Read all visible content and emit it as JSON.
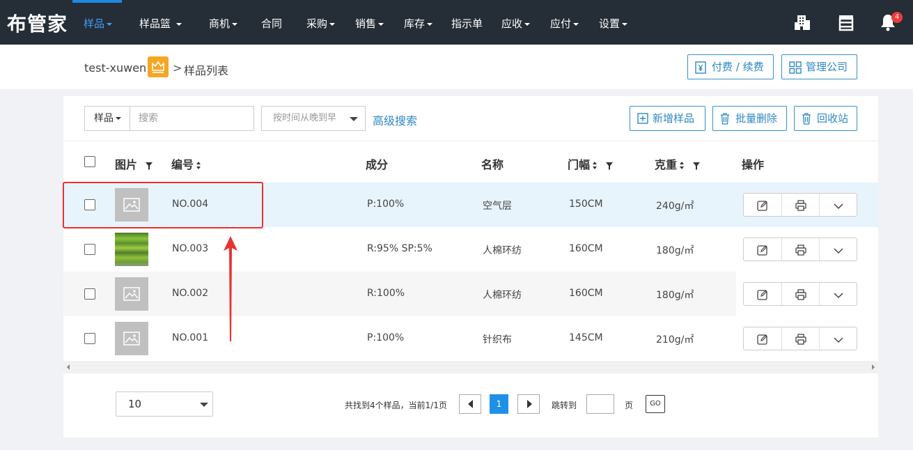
{
  "nav": {
    "logo": "布管家",
    "items": [
      {
        "label": "样品",
        "caret": true,
        "active": true
      },
      {
        "label": "样品篮 ",
        "caret": true
      },
      {
        "label": "商机",
        "caret": true
      },
      {
        "label": "合同",
        "caret": false
      },
      {
        "label": "采购",
        "caret": true
      },
      {
        "label": "销售",
        "caret": true
      },
      {
        "label": "库存",
        "caret": true
      },
      {
        "label": "指示单",
        "caret": false
      },
      {
        "label": "应收",
        "caret": true
      },
      {
        "label": "应付",
        "caret": true
      },
      {
        "label": "设置",
        "caret": true
      }
    ],
    "icons": [
      "building-icon",
      "store-icon",
      "bell-icon"
    ],
    "notification_count": "4"
  },
  "breadcrumb": {
    "user": "test-xuwen",
    "separator": ">",
    "page": "样品列表"
  },
  "header_buttons": {
    "pay": "付费 / 续费",
    "manage_company": "管理公司"
  },
  "toolbar": {
    "search_type": "样品",
    "search_placeholder": "搜索",
    "sort_option": "按时间从晚到早",
    "advanced_search": "高级搜索",
    "add_sample": "新增样品",
    "batch_delete": "批量删除",
    "recycle_bin": "回收站"
  },
  "table": {
    "columns": {
      "image": "图片",
      "code": "编号",
      "composition": "成分",
      "name": "名称",
      "width": "门幅",
      "weight": "克重",
      "actions": "操作"
    },
    "rows": [
      {
        "code": "NO.004",
        "composition": "P:100%",
        "name": "空气层",
        "width": "150CM",
        "weight": "240g/㎡",
        "image": "placeholder"
      },
      {
        "code": "NO.003",
        "composition": "R:95% SP:5%",
        "name": "人棉环纺",
        "width": "160CM",
        "weight": "180g/㎡",
        "image": "photo"
      },
      {
        "code": "NO.002",
        "composition": "R:100%",
        "name": "人棉环纺",
        "width": "160CM",
        "weight": "180g/㎡",
        "image": "placeholder"
      },
      {
        "code": "NO.001",
        "composition": "P:100%",
        "name": "针织布",
        "width": "145CM",
        "weight": "210g/㎡",
        "image": "placeholder"
      }
    ]
  },
  "pagination": {
    "page_size": "10",
    "info": "共找到4个样品，当前1/1页",
    "current_page": "1",
    "jump_label": "跳转到",
    "jump_unit": "页",
    "go": "GO"
  },
  "colors": {
    "nav_bg": "#252d36",
    "accent": "#2e88c4",
    "active_nav": "#3ea0f5",
    "highlight_row": "#e8f4fc",
    "annotation": "#e8322c"
  }
}
